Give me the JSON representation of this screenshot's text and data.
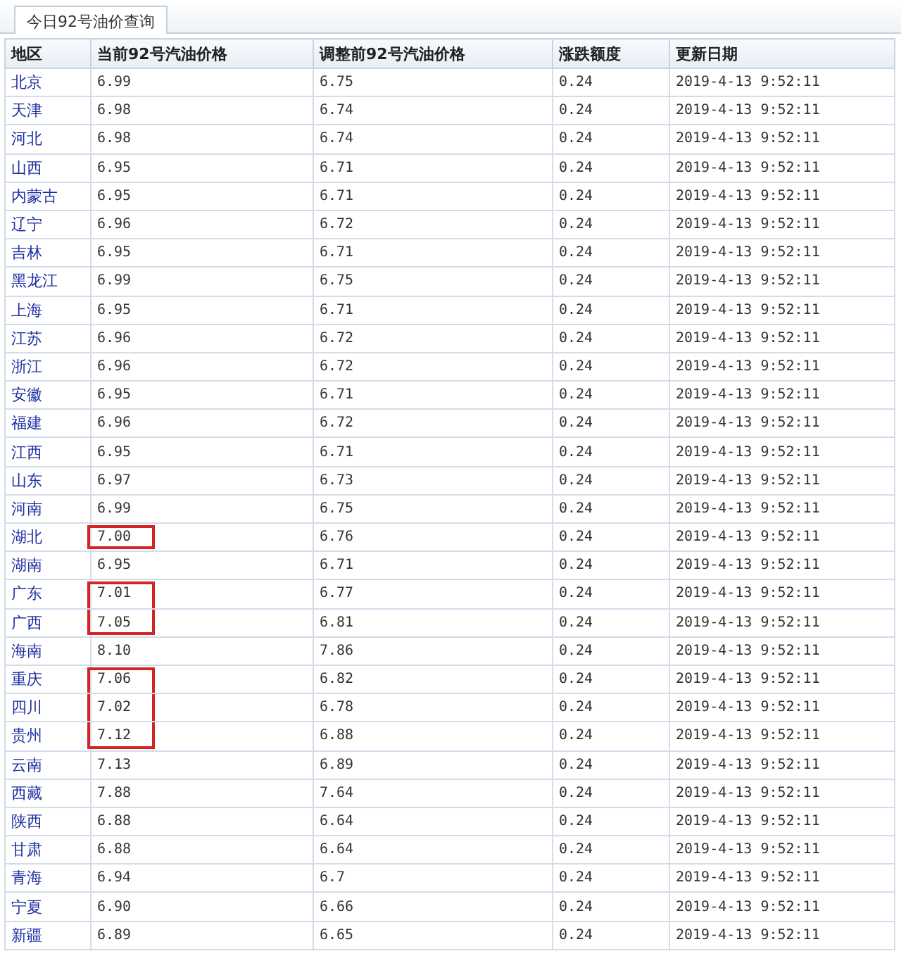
{
  "tabs": [
    {
      "label": "今日92号油价查询",
      "selected": true
    }
  ],
  "table": {
    "columns": [
      "地区",
      "当前92号汽油价格",
      "调整前92号汽油价格",
      "涨跌额度",
      "更新日期"
    ],
    "rows": [
      {
        "region": "北京",
        "current": "6.99",
        "previous": "6.75",
        "change": "0.24",
        "date": "2019-4-13 9:52:11",
        "boxed": false
      },
      {
        "region": "天津",
        "current": "6.98",
        "previous": "6.74",
        "change": "0.24",
        "date": "2019-4-13 9:52:11",
        "boxed": false
      },
      {
        "region": "河北",
        "current": "6.98",
        "previous": "6.74",
        "change": "0.24",
        "date": "2019-4-13 9:52:11",
        "boxed": false
      },
      {
        "region": "山西",
        "current": "6.95",
        "previous": "6.71",
        "change": "0.24",
        "date": "2019-4-13 9:52:11",
        "boxed": false
      },
      {
        "region": "内蒙古",
        "current": "6.95",
        "previous": "6.71",
        "change": "0.24",
        "date": "2019-4-13 9:52:11",
        "boxed": false
      },
      {
        "region": "辽宁",
        "current": "6.96",
        "previous": "6.72",
        "change": "0.24",
        "date": "2019-4-13 9:52:11",
        "boxed": false
      },
      {
        "region": "吉林",
        "current": "6.95",
        "previous": "6.71",
        "change": "0.24",
        "date": "2019-4-13 9:52:11",
        "boxed": false
      },
      {
        "region": "黑龙江",
        "current": "6.99",
        "previous": "6.75",
        "change": "0.24",
        "date": "2019-4-13 9:52:11",
        "boxed": false
      },
      {
        "region": "上海",
        "current": "6.95",
        "previous": "6.71",
        "change": "0.24",
        "date": "2019-4-13 9:52:11",
        "boxed": false
      },
      {
        "region": "江苏",
        "current": "6.96",
        "previous": "6.72",
        "change": "0.24",
        "date": "2019-4-13 9:52:11",
        "boxed": false
      },
      {
        "region": "浙江",
        "current": "6.96",
        "previous": "6.72",
        "change": "0.24",
        "date": "2019-4-13 9:52:11",
        "boxed": false
      },
      {
        "region": "安徽",
        "current": "6.95",
        "previous": "6.71",
        "change": "0.24",
        "date": "2019-4-13 9:52:11",
        "boxed": false
      },
      {
        "region": "福建",
        "current": "6.96",
        "previous": "6.72",
        "change": "0.24",
        "date": "2019-4-13 9:52:11",
        "boxed": false
      },
      {
        "region": "江西",
        "current": "6.95",
        "previous": "6.71",
        "change": "0.24",
        "date": "2019-4-13 9:52:11",
        "boxed": false
      },
      {
        "region": "山东",
        "current": "6.97",
        "previous": "6.73",
        "change": "0.24",
        "date": "2019-4-13 9:52:11",
        "boxed": false
      },
      {
        "region": "河南",
        "current": "6.99",
        "previous": "6.75",
        "change": "0.24",
        "date": "2019-4-13 9:52:11",
        "boxed": false
      },
      {
        "region": "湖北",
        "current": "7.00",
        "previous": "6.76",
        "change": "0.24",
        "date": "2019-4-13 9:52:11",
        "boxed": true
      },
      {
        "region": "湖南",
        "current": "6.95",
        "previous": "6.71",
        "change": "0.24",
        "date": "2019-4-13 9:52:11",
        "boxed": false
      },
      {
        "region": "广东",
        "current": "7.01",
        "previous": "6.77",
        "change": "0.24",
        "date": "2019-4-13 9:52:11",
        "boxed": true
      },
      {
        "region": "广西",
        "current": "7.05",
        "previous": "6.81",
        "change": "0.24",
        "date": "2019-4-13 9:52:11",
        "boxed": true
      },
      {
        "region": "海南",
        "current": "8.10",
        "previous": "7.86",
        "change": "0.24",
        "date": "2019-4-13 9:52:11",
        "boxed": false
      },
      {
        "region": "重庆",
        "current": "7.06",
        "previous": "6.82",
        "change": "0.24",
        "date": "2019-4-13 9:52:11",
        "boxed": true
      },
      {
        "region": "四川",
        "current": "7.02",
        "previous": "6.78",
        "change": "0.24",
        "date": "2019-4-13 9:52:11",
        "boxed": true
      },
      {
        "region": "贵州",
        "current": "7.12",
        "previous": "6.88",
        "change": "0.24",
        "date": "2019-4-13 9:52:11",
        "boxed": true
      },
      {
        "region": "云南",
        "current": "7.13",
        "previous": "6.89",
        "change": "0.24",
        "date": "2019-4-13 9:52:11",
        "boxed": false
      },
      {
        "region": "西藏",
        "current": "7.88",
        "previous": "7.64",
        "change": "0.24",
        "date": "2019-4-13 9:52:11",
        "boxed": false
      },
      {
        "region": "陕西",
        "current": "6.88",
        "previous": "6.64",
        "change": "0.24",
        "date": "2019-4-13 9:52:11",
        "boxed": false
      },
      {
        "region": "甘肃",
        "current": "6.88",
        "previous": "6.64",
        "change": "0.24",
        "date": "2019-4-13 9:52:11",
        "boxed": false
      },
      {
        "region": "青海",
        "current": "6.94",
        "previous": "6.7",
        "change": "0.24",
        "date": "2019-4-13 9:52:11",
        "boxed": false
      },
      {
        "region": "宁夏",
        "current": "6.90",
        "previous": "6.66",
        "change": "0.24",
        "date": "2019-4-13 9:52:11",
        "boxed": false
      },
      {
        "region": "新疆",
        "current": "6.89",
        "previous": "6.65",
        "change": "0.24",
        "date": "2019-4-13 9:52:11",
        "boxed": false
      }
    ]
  }
}
